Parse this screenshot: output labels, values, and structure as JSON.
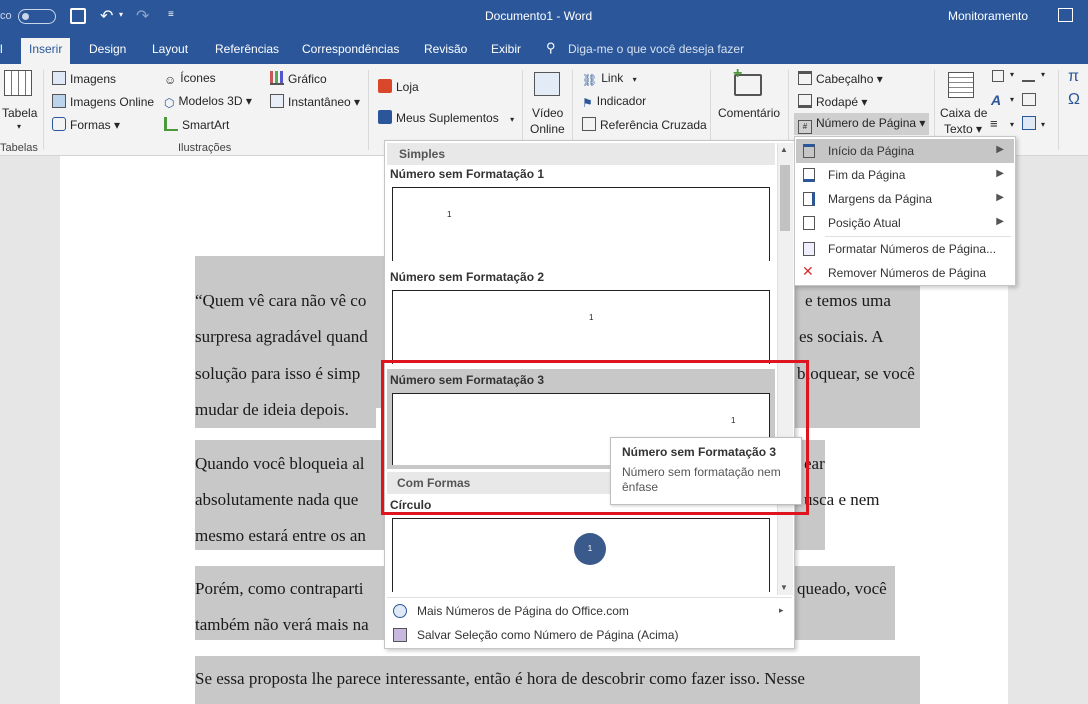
{
  "titlebar": {
    "doc_title": "Documento1 - Word",
    "user": "Monitoramento",
    "autosave": "co"
  },
  "tabs": [
    "l",
    "Inserir",
    "Design",
    "Layout",
    "Referências",
    "Correspondências",
    "Revisão",
    "Exibir"
  ],
  "search": "Diga-me o que você deseja fazer",
  "ribbon": {
    "tabela": "Tabela",
    "tabelas_group": "Tabelas",
    "imagens": "Imagens",
    "imagens_online": "Imagens Online",
    "formas": "Formas",
    "icones": "Ícones",
    "modelos3d": "Modelos 3D",
    "smartart": "SmartArt",
    "grafico": "Gráfico",
    "instantaneo": "Instantâneo",
    "ilustracoes_group": "Ilustrações",
    "loja": "Loja",
    "meus_suplementos": "Meus Suplementos",
    "video": "Vídeo",
    "online": "Online",
    "link": "Link",
    "indicador": "Indicador",
    "referencia_cruzada": "Referência Cruzada",
    "comentario": "Comentário",
    "cabecalho": "Cabeçalho",
    "rodape": "Rodapé",
    "numero_pagina": "Número de Página",
    "caixa_de": "Caixa de",
    "texto": "Texto"
  },
  "dropdown": {
    "section_simples": "Simples",
    "item1": "Número sem Formatação 1",
    "item2": "Número sem Formatação 2",
    "item3": "Número sem Formatação 3",
    "section_formas": "Com Formas",
    "circulo": "Círculo",
    "num": "1",
    "more": "Mais Números de Página do Office.com",
    "save": "Salvar Seleção como Número de Página (Acima)"
  },
  "submenu": {
    "inicio": "Início da Página",
    "fim": "Fim da Página",
    "margens": "Margens da Página",
    "posicao": "Posição Atual",
    "formatar": "Formatar Números de Página...",
    "remover": "Remover Números de Página"
  },
  "tooltip": {
    "title": "Número sem Formatação 3",
    "desc1": "Número sem formatação nem",
    "desc2": "ênfase"
  },
  "doc": {
    "l1a": "“Quem vê cara não vê co",
    "l1b": "e temos uma",
    "l2a": "surpresa agradável quand",
    "l2b": "es sociais. A",
    "l3a": "solução para isso é simp",
    "l3b": "bloquear, se você",
    "l4": "mudar de ideia depois.",
    "l5a": "Quando você bloqueia al",
    "l5b": "ear",
    "l6a": "absolutamente nada que",
    "l6b": "usca e nem",
    "l7": "mesmo estará entre os an",
    "l8a": "Porém, como contraparti",
    "l8b": "queado, você",
    "l9": "também não verá mais na",
    "l10": "Se essa proposta lhe parece interessante, então é hora de descobrir como fazer isso. Nesse"
  }
}
